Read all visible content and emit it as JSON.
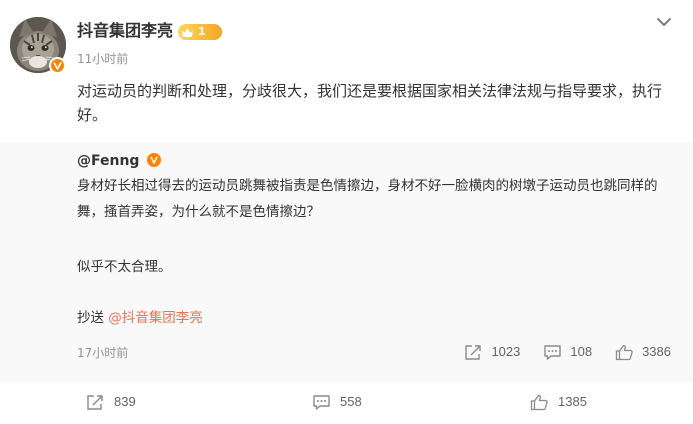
{
  "post": {
    "author": "抖音集团李亮",
    "level": "1",
    "time": "11小时前",
    "content": "对运动员的判断和处理，分歧很大，我们还是要根据国家相关法律法规与指导要求，执行好。",
    "actions": {
      "repost_count": "839",
      "comment_count": "558",
      "like_count": "1385"
    }
  },
  "repost": {
    "author": "@Fenng",
    "paragraph1": "身材好长相过得去的运动员跳舞被指责是色情擦边，身材不好一脸横肉的树墩子运动员也跳同样的舞，搔首弄姿，为什么就不是色情擦边？",
    "paragraph2": "似乎不太合理。",
    "cc_prefix": "抄送 ",
    "cc_mention": "@抖音集团李亮",
    "time": "17小时前",
    "actions": {
      "repost_count": "1023",
      "comment_count": "108",
      "like_count": "3386"
    }
  },
  "icons": [
    "more-chevron-icon",
    "level-crown-icon",
    "verified-icon",
    "repost-icon",
    "comment-icon",
    "like-icon"
  ],
  "colors": {
    "accent": "#ff8200",
    "mention": "#eb7350",
    "meta_text": "#939393",
    "repost_bg": "#f9f9f9"
  }
}
